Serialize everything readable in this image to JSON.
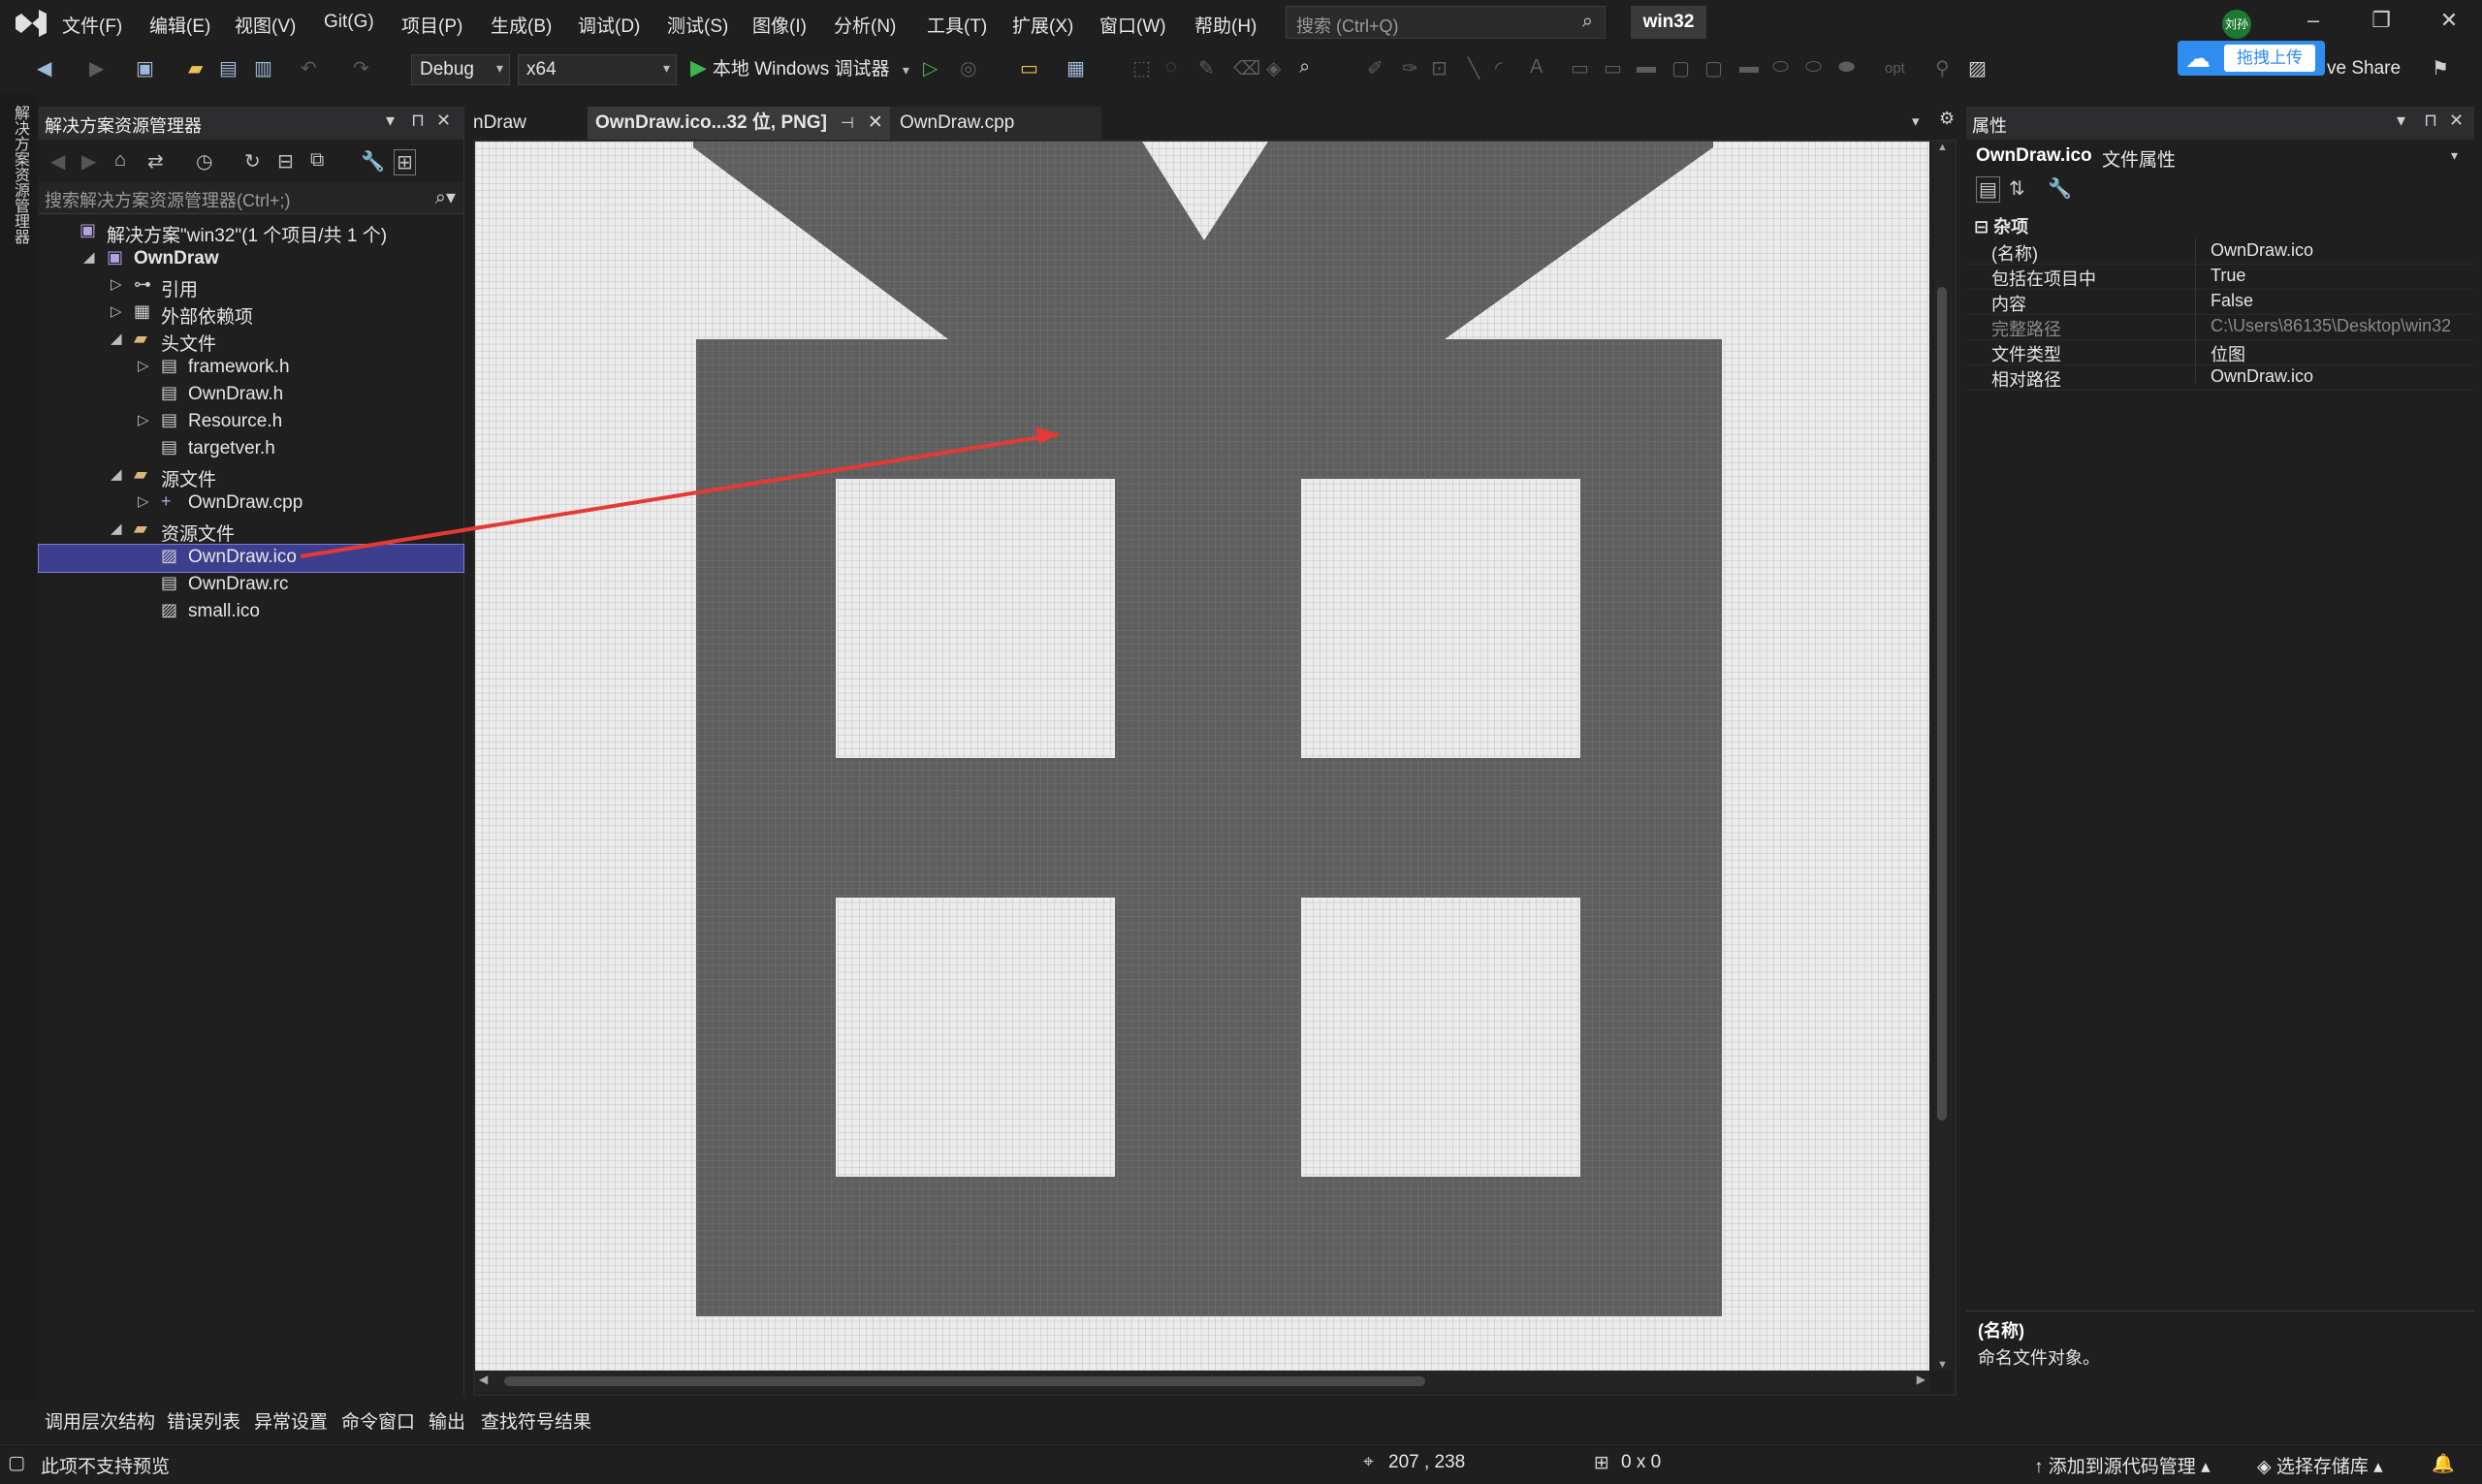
{
  "menu": [
    "文件(F)",
    "编辑(E)",
    "视图(V)",
    "Git(G)",
    "项目(P)",
    "生成(B)",
    "调试(D)",
    "测试(S)",
    "图像(I)",
    "分析(N)",
    "工具(T)",
    "扩展(X)",
    "窗口(W)",
    "帮助(H)"
  ],
  "search": {
    "placeholder": "搜索 (Ctrl+Q)"
  },
  "solution_badge": "win32",
  "user_initials": "刘孙",
  "toolbar": {
    "config": "Debug",
    "platform": "x64",
    "run_label": "本地 Windows 调试器",
    "upload_label": "拖拽上传",
    "liveshare_label": "ve Share",
    "opt_label": "opt"
  },
  "left_vtab": "解决方案资源管理器",
  "solution_explorer": {
    "title": "解决方案资源管理器",
    "search_placeholder": "搜索解决方案资源管理器(Ctrl+;)",
    "tree": [
      {
        "label": "解决方案\"win32\"(1 个项目/共 1 个)",
        "level": 0,
        "arrow": "",
        "icon": "solution-icon"
      },
      {
        "label": "OwnDraw",
        "level": 1,
        "arrow": "expanded",
        "icon": "project-icon",
        "bold": true
      },
      {
        "label": "引用",
        "level": 2,
        "arrow": "collapsed",
        "icon": "references-icon"
      },
      {
        "label": "外部依赖项",
        "level": 2,
        "arrow": "collapsed",
        "icon": "dependencies-icon"
      },
      {
        "label": "头文件",
        "level": 2,
        "arrow": "expanded",
        "icon": "folder-icon"
      },
      {
        "label": "framework.h",
        "level": 3,
        "arrow": "collapsed",
        "icon": "header-file-icon"
      },
      {
        "label": "OwnDraw.h",
        "level": 3,
        "arrow": "",
        "icon": "header-file-icon"
      },
      {
        "label": "Resource.h",
        "level": 3,
        "arrow": "collapsed",
        "icon": "header-file-icon"
      },
      {
        "label": "targetver.h",
        "level": 3,
        "arrow": "",
        "icon": "header-file-icon"
      },
      {
        "label": "源文件",
        "level": 2,
        "arrow": "expanded",
        "icon": "folder-icon"
      },
      {
        "label": "OwnDraw.cpp",
        "level": 3,
        "arrow": "collapsed",
        "icon": "cpp-file-icon"
      },
      {
        "label": "资源文件",
        "level": 2,
        "arrow": "expanded",
        "icon": "folder-icon"
      },
      {
        "label": "OwnDraw.ico",
        "level": 3,
        "arrow": "",
        "icon": "image-file-icon",
        "selected": true
      },
      {
        "label": "OwnDraw.rc",
        "level": 3,
        "arrow": "",
        "icon": "rc-file-icon"
      },
      {
        "label": "small.ico",
        "level": 3,
        "arrow": "",
        "icon": "image-file-icon"
      }
    ]
  },
  "doc_tabs": [
    {
      "label": "nDraw",
      "active": false
    },
    {
      "label": "OwnDraw.ico...32 位, PNG]",
      "active": true
    },
    {
      "label": "OwnDraw.cpp",
      "active": false
    }
  ],
  "properties": {
    "title": "属性",
    "object_name": "OwnDraw.ico",
    "object_type": "文件属性",
    "category": "杂项",
    "rows": [
      {
        "key": "(名称)",
        "value": "OwnDraw.ico",
        "dim": false
      },
      {
        "key": "包括在项目中",
        "value": "True",
        "dim": false
      },
      {
        "key": "内容",
        "value": "False",
        "dim": false
      },
      {
        "key": "完整路径",
        "value": "C:\\Users\\86135\\Desktop\\win32",
        "dim": true
      },
      {
        "key": "文件类型",
        "value": "位图",
        "dim": false
      },
      {
        "key": "相对路径",
        "value": "OwnDraw.ico",
        "dim": false
      }
    ],
    "desc_title": "(名称)",
    "desc_text": "命名文件对象。"
  },
  "bottom_tabs": [
    "调用层次结构",
    "错误列表",
    "异常设置",
    "命令窗口",
    "输出",
    "查找符号结果"
  ],
  "status": {
    "preview": "此项不支持预览",
    "cursor": "207 , 238",
    "selection": "0 x 0",
    "source_control": "添加到源代码管理",
    "repo": "选择存储库"
  },
  "colors": {
    "accent": "#3e3e8f",
    "canvas_light": "#e8e8e8",
    "canvas_dark": "#606060",
    "arrow": "#e53935",
    "run_green": "#3fb34f"
  }
}
